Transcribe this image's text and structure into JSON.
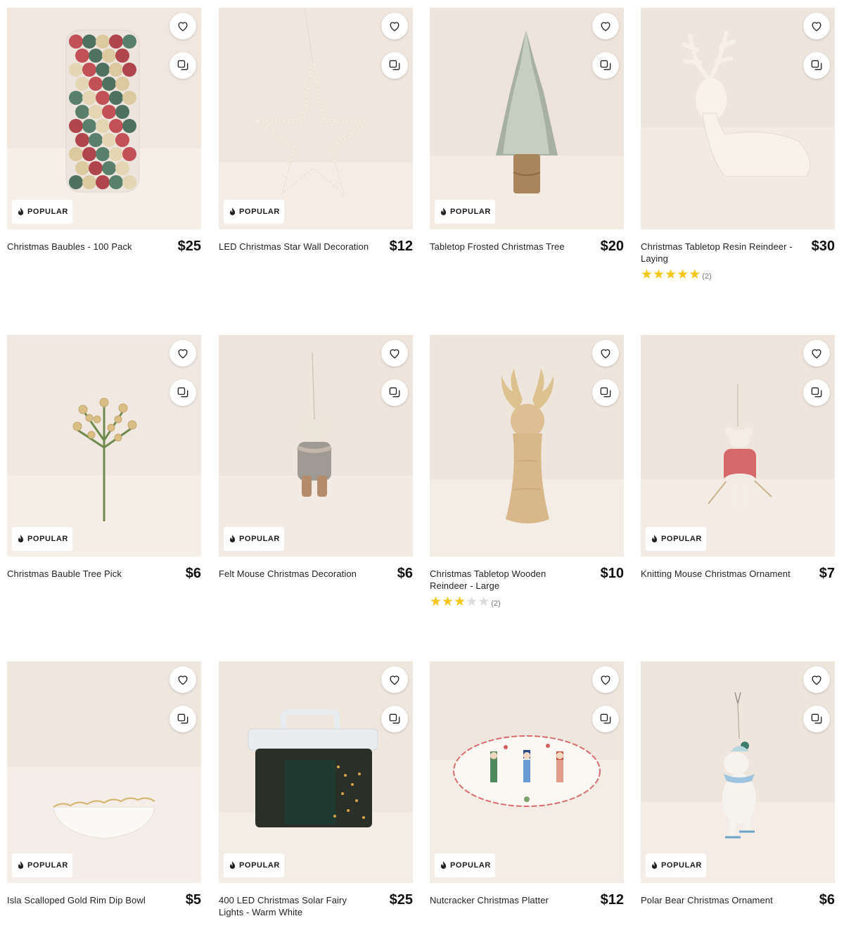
{
  "badge_label": "POPULAR",
  "icons": {
    "wishlist": "heart-icon",
    "compare": "compare-icon",
    "badge": "flame-icon",
    "rating": "star-icon"
  },
  "colors": {
    "star_on": "#f5c518",
    "star_off": "#dcdcdc",
    "badge_bg": "#ffffff",
    "price": "#111111"
  },
  "products": [
    {
      "name": "Christmas Baubles - 100 Pack",
      "price": "$25",
      "popular": true
    },
    {
      "name": "LED Christmas Star Wall Decoration",
      "price": "$12",
      "popular": true
    },
    {
      "name": "Tabletop Frosted Christmas Tree",
      "price": "$20",
      "popular": true
    },
    {
      "name": "Christmas Tabletop Resin Reindeer - Laying",
      "price": "$30",
      "popular": false,
      "rating": 5,
      "rating_count": "(2)"
    },
    {
      "name": "Christmas Bauble Tree Pick",
      "price": "$6",
      "popular": true
    },
    {
      "name": "Felt Mouse Christmas Decoration",
      "price": "$6",
      "popular": true
    },
    {
      "name": "Christmas Tabletop Wooden Reindeer - Large",
      "price": "$10",
      "popular": false,
      "rating": 3,
      "rating_count": "(2)"
    },
    {
      "name": "Knitting Mouse Christmas Ornament",
      "price": "$7",
      "popular": true
    },
    {
      "name": "Isla Scalloped Gold Rim Dip Bowl",
      "price": "$5",
      "popular": true
    },
    {
      "name": "400 LED Christmas Solar Fairy Lights - Warm White",
      "price": "$25",
      "popular": true
    },
    {
      "name": "Nutcracker Christmas Platter",
      "price": "$12",
      "popular": true
    },
    {
      "name": "Polar Bear Christmas Ornament",
      "price": "$6",
      "popular": true
    }
  ]
}
